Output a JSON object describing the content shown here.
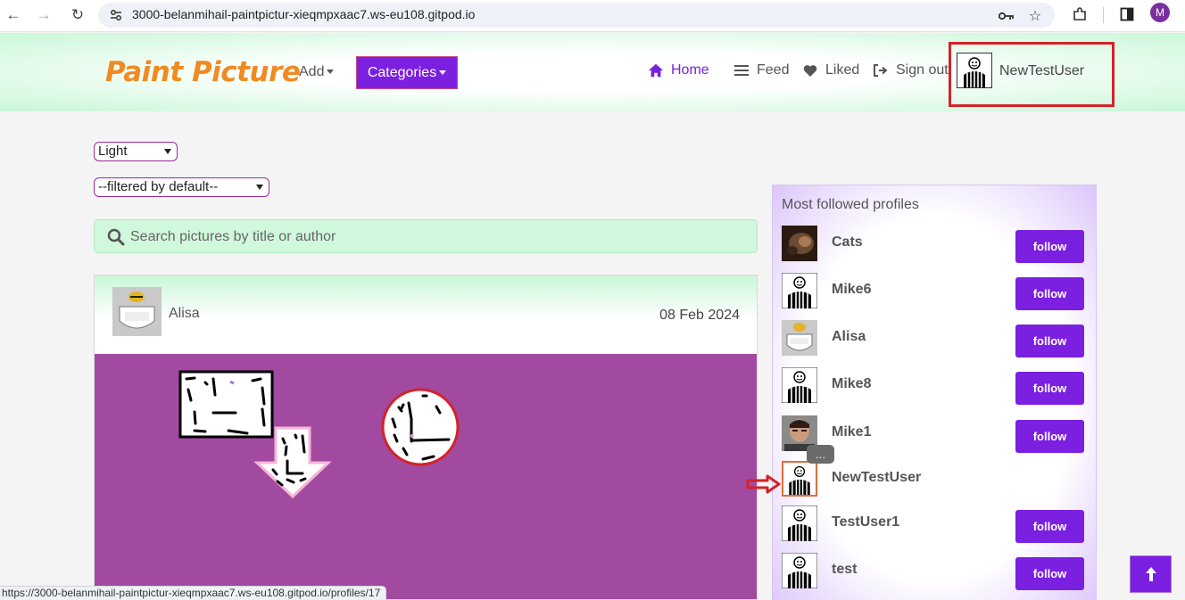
{
  "browser": {
    "url": "3000-belanmihail-paintpictur-xieqmpxaac7.ws-eu108.gitpod.io",
    "profile_initial": "M",
    "status_url": "https://3000-belanmihail-paintpictur-xieqmpxaac7.ws-eu108.gitpod.io/profiles/17"
  },
  "header": {
    "brand": "Paint Picture",
    "add_label": "Add",
    "categories_label": "Categories",
    "nav": [
      {
        "label": "Home",
        "icon": "home-icon",
        "active": true
      },
      {
        "label": "Feed",
        "icon": "list-icon"
      },
      {
        "label": "Liked",
        "icon": "heart-icon"
      },
      {
        "label": "Sign out",
        "icon": "sign-out-icon"
      }
    ],
    "username": "NewTestUser"
  },
  "controls": {
    "theme_value": "Light",
    "filter_value": "--filtered by default--",
    "search_placeholder": "Search pictures by title or author"
  },
  "post": {
    "author": "Alisa",
    "date": "08 Feb 2024"
  },
  "sidebar": {
    "title": "Most followed profiles",
    "follow_label": "follow",
    "profiles": [
      {
        "name": "Cats",
        "avatar": "cat-photo",
        "follow": true
      },
      {
        "name": "Mike6",
        "avatar": "default-avatar",
        "follow": true
      },
      {
        "name": "Alisa",
        "avatar": "bee-badge",
        "follow": true
      },
      {
        "name": "Mike8",
        "avatar": "default-avatar",
        "follow": true
      },
      {
        "name": "Mike1",
        "avatar": "man-photo",
        "follow": true
      },
      {
        "name": "NewTestUser",
        "avatar": "default-avatar",
        "follow": false
      },
      {
        "name": "TestUser1",
        "avatar": "default-avatar",
        "follow": true
      },
      {
        "name": "test",
        "avatar": "default-avatar",
        "follow": true
      }
    ]
  },
  "tooltip": {
    "text": "…"
  },
  "colors": {
    "accent": "#7b1fe0",
    "brand": "#ef8b22",
    "highlight": "#d2232a",
    "canvas": "#a249a0"
  }
}
